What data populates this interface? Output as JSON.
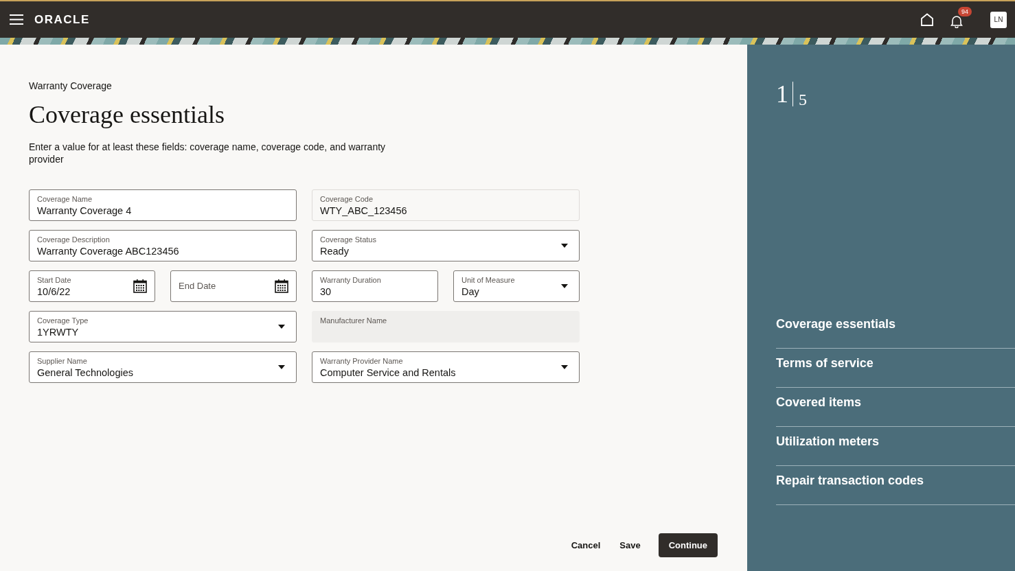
{
  "header": {
    "logo": "ORACLE",
    "notification_count": "94",
    "avatar_initials": "LN"
  },
  "page": {
    "breadcrumb": "Warranty Coverage",
    "title": "Coverage essentials",
    "instructions": "Enter a value for at least these fields: coverage name, coverage code, and warranty provider"
  },
  "form_rows": [
    [
      {
        "kind": "text",
        "label": "Coverage Name",
        "value": "Warranty Coverage 4"
      },
      {
        "kind": "readonly",
        "label": "Coverage Code",
        "value": "WTY_ABC_123456"
      }
    ],
    [
      {
        "kind": "text",
        "label": "Coverage Description",
        "value": "Warranty Coverage ABC123456"
      },
      {
        "kind": "select",
        "label": "Coverage Status",
        "value": "Ready"
      }
    ],
    [
      {
        "kind": "date",
        "label": "Start Date",
        "value": "10/6/22"
      },
      {
        "kind": "date",
        "label": "End Date"
      },
      {
        "kind": "text",
        "label": "Warranty Duration",
        "value": "30"
      },
      {
        "kind": "select",
        "label": "Unit of Measure",
        "value": "Day"
      }
    ],
    [
      {
        "kind": "select",
        "label": "Coverage Type",
        "value": "1YRWTY"
      },
      {
        "kind": "disabled",
        "label": "Manufacturer Name"
      }
    ],
    [
      {
        "kind": "select",
        "label": "Supplier Name",
        "value": "General Technologies"
      },
      {
        "kind": "select",
        "label": "Warranty Provider Name",
        "value": "Computer Service and Rentals"
      }
    ]
  ],
  "buttons": [
    {
      "kind": "link",
      "label": "Cancel"
    },
    {
      "kind": "link",
      "label": "Save"
    },
    {
      "kind": "primary",
      "label": "Continue"
    }
  ],
  "progress": {
    "current": "1",
    "total": "5"
  },
  "steps": [
    "Coverage essentials",
    "Terms of service",
    "Covered items",
    "Utilization meters",
    "Repair transaction codes"
  ]
}
